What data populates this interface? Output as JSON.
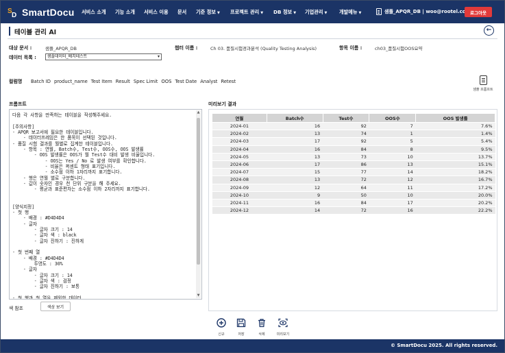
{
  "app": {
    "logo_text": "SmartDocu"
  },
  "nav": [
    {
      "label": "서비스 소개",
      "caret": false
    },
    {
      "label": "기능 소개",
      "caret": false
    },
    {
      "label": "서비스 이용",
      "caret": false
    },
    {
      "label": "문서",
      "caret": false
    },
    {
      "label": "기준 정보",
      "caret": true
    },
    {
      "label": "프로젝트 관리",
      "caret": true
    },
    {
      "label": "DB 정보",
      "caret": true
    },
    {
      "label": "기업관리",
      "caret": true
    },
    {
      "label": "개발메뉴",
      "caret": true
    }
  ],
  "user": {
    "text": "샘플_APQR_DB | woo@rootel.co.kr",
    "logout": "로그아웃"
  },
  "page": {
    "title": "테이블 관리 AI"
  },
  "meta": {
    "target_doc_label": "대상 문서 :",
    "target_doc_value": "샘플_APQR_DB",
    "chapter_label": "챕터 이름 :",
    "chapter_value": "Ch 03. 품질시험경과분석 (Quality Testing Analysis)",
    "item_label": "항목 이름 :",
    "item_value": "ch03_품질시험OOS요약",
    "data_list_label": "데이터 목록 :",
    "data_list_value": "샘플데이터_배치테스트"
  },
  "columns": {
    "label": "컬럼명",
    "items": [
      "Batch ID",
      "product_name",
      "Test Item",
      "Result",
      "Spec Limit",
      "OOS",
      "Test Date",
      "Analyst",
      "Retest"
    ],
    "prompt_gen_label": "샘플 프롬프트"
  },
  "prompt": {
    "label": "프롬프트",
    "text": "다음 각 사항을 만족하는 테이블을 작성해주세요.\n\n[주의사항]\n- APQR 보고서에 필요한 테이블입니다.\n    - 데이터프레임은 한 품목이 선택된 것입니다.\n- 품질 시험 결과를 월별로 집계한 테이블입니다.\n    - 항목 : 연월, Batch수, Test수, OOS수, OOS 발생률\n        - OOS 발생률은 OOS가 월 Test수 대비 발생 비율입니다.\n            - OOS는 Yes / No 로 발생 여부를 확인합니다.\n            - 비율은 퍼센트 형태 표기입니다.\n            - 소수점 이하 1자리까지 표기합니다.\n    - 행은 연월 별로 구분합니다.\n    - 값이 숫자인 경우 천 단위 구분을 해 주세요.\n        - 평균과 표준편차는 소수점 이하 2자리까지 표기합니다.\n\n\n[양식지정]\n- 첫 행\n    - 배경 : #D4D4D4\n    - 글자\n        - 글자 크기 : 14\n        - 글자 색 : black\n        - 글자 진하기 : 진하게\n\n- 첫 번째 열\n    - 배경 : #D4D4D4\n        투명도 : 30%\n    - 글자\n        - 글자 크기 : 14\n        - 글자 색 : 검정\n        - 글자 진하기 : 보통\n\n- 첫 행과 첫 열을 제외한 데이터"
  },
  "color_ref": {
    "label": "색 참조",
    "button": "색상 보기"
  },
  "result": {
    "label": "미리보기 결과",
    "headers": [
      "연월",
      "Batch수",
      "Test수",
      "OOS수",
      "OOS 발생률"
    ],
    "rows": [
      [
        "2024-01",
        "16",
        "92",
        "7",
        "7.6%"
      ],
      [
        "2024-02",
        "13",
        "74",
        "1",
        "1.4%"
      ],
      [
        "2024-03",
        "17",
        "92",
        "5",
        "5.4%"
      ],
      [
        "2024-04",
        "16",
        "84",
        "8",
        "9.5%"
      ],
      [
        "2024-05",
        "13",
        "73",
        "10",
        "13.7%"
      ],
      [
        "2024-06",
        "17",
        "86",
        "13",
        "15.1%"
      ],
      [
        "2024-07",
        "15",
        "77",
        "14",
        "18.2%"
      ],
      [
        "2024-08",
        "13",
        "72",
        "12",
        "16.7%"
      ],
      [
        "2024-09",
        "12",
        "64",
        "11",
        "17.2%"
      ],
      [
        "2024-10",
        "9",
        "50",
        "10",
        "20.0%"
      ],
      [
        "2024-11",
        "16",
        "84",
        "17",
        "20.2%"
      ],
      [
        "2024-12",
        "14",
        "72",
        "16",
        "22.2%"
      ]
    ]
  },
  "toolbar": {
    "new": "신규",
    "save": "저장",
    "delete": "삭제",
    "preview": "미리보기"
  },
  "footer": {
    "copyright": "© SmartDocu 2025. All rights reserved."
  },
  "colors": {
    "header_bg": "#1b3466",
    "logout_bg": "#e23a3a",
    "table_header_bg": "#D4D4D4"
  }
}
